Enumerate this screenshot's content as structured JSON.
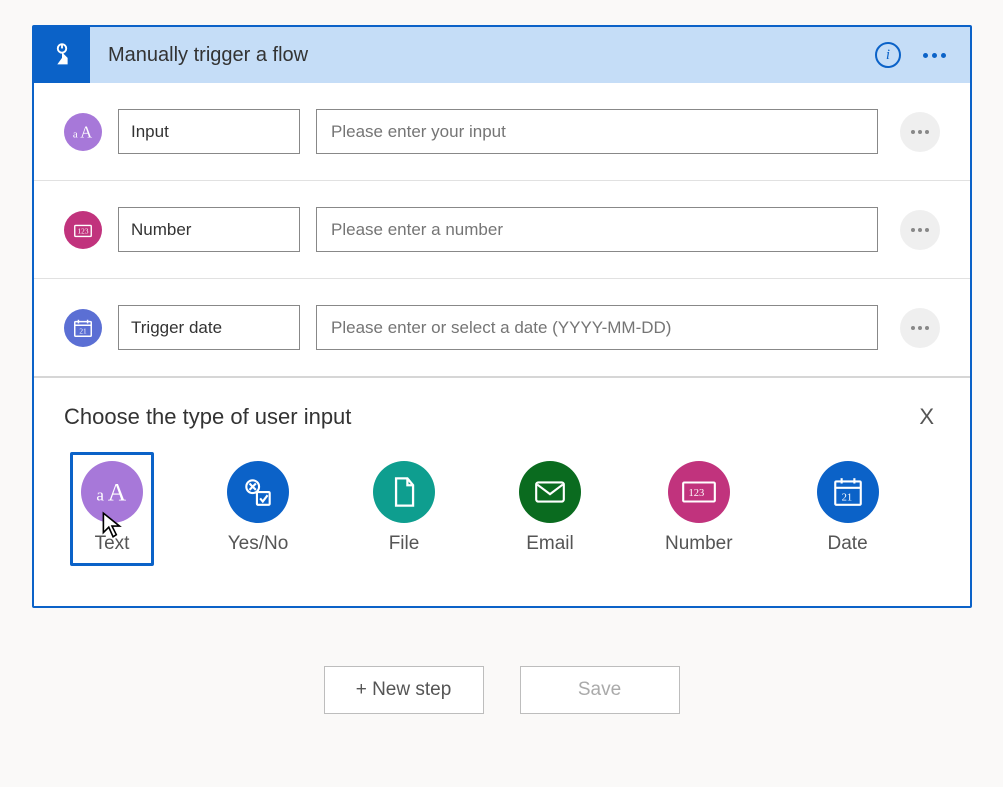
{
  "header": {
    "title": "Manually trigger a flow"
  },
  "inputs": [
    {
      "icon": "text",
      "name": "Input",
      "placeholder": "Please enter your input"
    },
    {
      "icon": "number",
      "name": "Number",
      "placeholder": "Please enter a number"
    },
    {
      "icon": "date",
      "name": "Trigger date",
      "placeholder": "Please enter or select a date (YYYY-MM-DD)"
    }
  ],
  "choose": {
    "title": "Choose the type of user input",
    "close": "X",
    "types": [
      {
        "key": "text",
        "label": "Text"
      },
      {
        "key": "yesno",
        "label": "Yes/No"
      },
      {
        "key": "file",
        "label": "File"
      },
      {
        "key": "email",
        "label": "Email"
      },
      {
        "key": "number",
        "label": "Number"
      },
      {
        "key": "date",
        "label": "Date"
      }
    ]
  },
  "footer": {
    "new_step": "+ New step",
    "save": "Save"
  }
}
